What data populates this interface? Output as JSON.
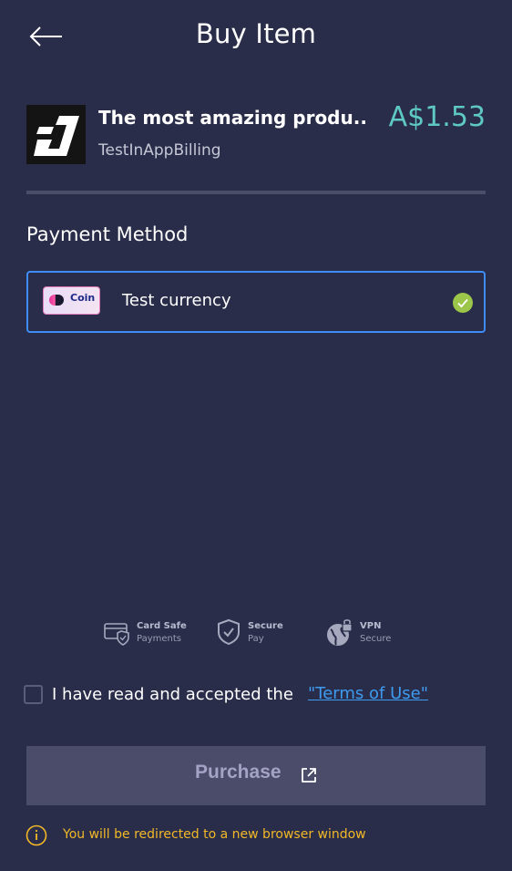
{
  "header": {
    "title": "Buy Item",
    "back_icon": "arrow-left-icon"
  },
  "product": {
    "name": "The most amazing produ..",
    "app": "TestInAppBilling",
    "price": "A$1.53",
    "logo_icon": "app-logo-icon"
  },
  "payment": {
    "section_label": "Payment Method",
    "selected_method": {
      "badge_text": "Coin",
      "label": "Test currency",
      "selected": true
    }
  },
  "trust_badges": [
    {
      "title": "Card Safe",
      "subtitle": "Payments",
      "icon": "card-shield-icon"
    },
    {
      "title": "Secure",
      "subtitle": "Pay",
      "icon": "shield-check-icon"
    },
    {
      "title": "VPN",
      "subtitle": "Secure",
      "icon": "globe-lock-icon"
    }
  ],
  "terms": {
    "text": "I have read and accepted the",
    "link": "\"Terms of Use\"",
    "checked": false
  },
  "purchase": {
    "label": "Purchase",
    "icon": "external-link-icon"
  },
  "notice": {
    "text": "You will be redirected to a new browser window",
    "icon": "info-icon"
  },
  "colors": {
    "background": "#2a2d4a",
    "price": "#5ec9c2",
    "selection_border": "#3d8df5",
    "check": "#9bc64a",
    "link": "#3d9bf0",
    "notice": "#f2b827",
    "button": "#4a4c6a"
  }
}
